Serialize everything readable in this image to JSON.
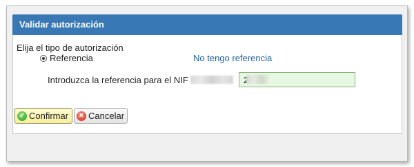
{
  "dialog": {
    "title": "Validar autorización"
  },
  "form": {
    "section_label": "Elija el tipo de autorización",
    "radio_option_label": "Referencia",
    "radio_selected": true,
    "no_reference_link": "No tengo referencia",
    "nif_label": "Introduzca la referencia para el NIF",
    "reference_value": "2     5"
  },
  "buttons": {
    "confirm_label": "Confirmar",
    "cancel_label": "Cancelar"
  },
  "icons": {
    "confirm": "check-circle-icon",
    "cancel": "x-circle-icon",
    "radio": "radio-selected-icon"
  },
  "colors": {
    "title_bar": "#3878b4",
    "link": "#1f5fa8",
    "input_background": "#e7f8e2",
    "confirm_button": "#f7ee9c"
  }
}
